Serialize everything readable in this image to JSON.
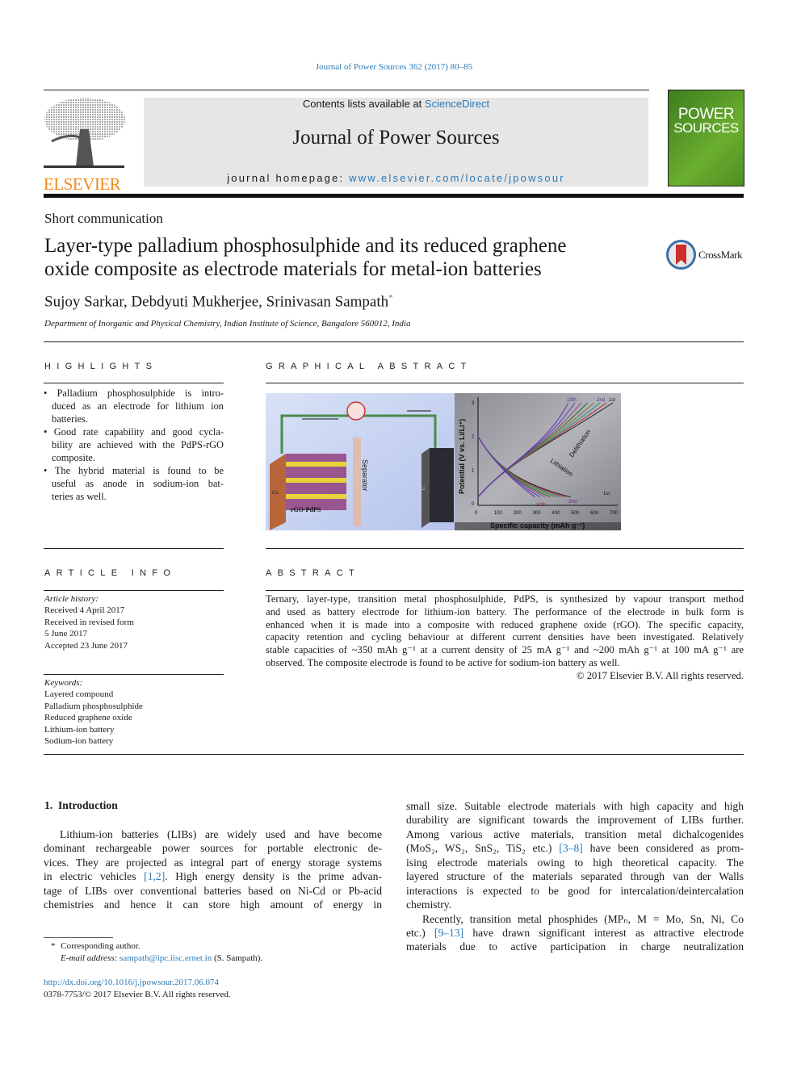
{
  "header": {
    "citation": "Journal of Power Sources 362 (2017) 80–85",
    "contents_prefix": "Contents lists available at ",
    "contents_link": "ScienceDirect",
    "journal_title": "Journal of Power Sources",
    "homepage_prefix": "journal homepage: ",
    "homepage_link": "www.elsevier.com/locate/jpowsour",
    "publisher_logo": "ELSEVIER",
    "cover": {
      "line1": "POWER",
      "line2": "SOURCES",
      "color": "#5a9a2a"
    },
    "crossmark": "CrossMark"
  },
  "article": {
    "type": "Short communication",
    "title_lines": [
      "Layer-type palladium phosphosulphide and its reduced graphene",
      "oxide composite as electrode materials for metal-ion batteries"
    ],
    "authors": "Sujoy Sarkar, Debdyuti Mukherjee, Srinivasan Sampath",
    "author_mark": "*",
    "affiliation": "Department of Inorganic and Physical Chemistry, Indian Institute of Science, Bangalore 560012, India"
  },
  "highlights": {
    "heading": "HIGHLIGHTS",
    "lines": [
      [
        "• Palladium phosphosulphide is intro-"
      ],
      [
        "duced as an electrode for lithium ion"
      ],
      [
        "batteries."
      ],
      [
        "• Good rate capability and good cycla-"
      ],
      [
        "bility are achieved with the PdPS-rGO"
      ],
      [
        "composite."
      ],
      [
        "• The hybrid material is found to be"
      ],
      [
        "useful as anode in sodium-ion bat-"
      ],
      [
        "teries as well."
      ]
    ]
  },
  "graphical_abstract": {
    "heading": "GRAPHICAL ABSTRACT",
    "labels": {
      "separator": "Separator",
      "electrode": "rGO-PdPS",
      "cu": "Cu",
      "li": "Li",
      "ylabel": "Potential (V vs. Li/Li⁺)",
      "xlabel": "Specific capacity (mAh g⁻¹)",
      "delithiation": "Delithiation",
      "lithiation": "Lithiation",
      "cycle_10_top": "10th",
      "cycle_2_top": "2nd",
      "cycle_1_top": "1st",
      "cycle_10_bottom": "10th",
      "cycle_2_bottom": "2nd",
      "cycle_1_bottom": "1st",
      "xticks": [
        "0",
        "100",
        "200",
        "300",
        "400",
        "500",
        "600",
        "700"
      ],
      "yticks": [
        "0",
        "1",
        "2",
        "3"
      ]
    }
  },
  "article_info": {
    "heading": "ARTICLE INFO",
    "history_label": "Article history:",
    "history": [
      "Received 4 April 2017",
      "Received in revised form",
      "5 June 2017",
      "Accepted 23 June 2017"
    ],
    "keywords_label": "Keywords:",
    "keywords": [
      "Layered compound",
      "Palladium phosphosulphide",
      "Reduced graphene oxide",
      "Lithium-ion battery",
      "Sodium-ion battery"
    ]
  },
  "abstract": {
    "heading": "ABSTRACT",
    "lines": [
      [
        "Ternary, layer-type, transition metal phosphosulphide, PdPS, is synthesized by vapour transport method"
      ],
      [
        "and used as battery electrode for lithium-ion battery. The performance of the electrode in bulk form is"
      ],
      [
        "enhanced when it is made into a composite with reduced graphene oxide (rGO). The specific capacity,"
      ],
      [
        "capacity retention and cycling behaviour at different current densities have been investigated. Relatively"
      ],
      [
        "stable capacities of ~350 mAh g⁻¹ at a current density of 25 mA g⁻¹ and ~200 mAh g⁻¹ at 100 mA g⁻¹ are"
      ],
      [
        "observed. The composite electrode is found to be active for sodium-ion battery as well."
      ]
    ],
    "copyright": "© 2017 Elsevier B.V. All rights reserved."
  },
  "intro": {
    "heading": "1.  Introduction",
    "left_lines": [
      [
        "Lithium-ion batteries (LIBs) are widely used and have become"
      ],
      [
        "dominant rechargeable power sources for portable electronic de-"
      ],
      [
        "vices. They are projected as integral part of energy storage systems"
      ],
      [
        "in electric vehicles ",
        {
          "ref": "[1,2]"
        },
        ". High energy density is the prime advan-"
      ],
      [
        "tage of LIBs over conventional batteries based on Ni-Cd or Pb-acid"
      ],
      [
        "chemistries and hence it can store high amount of energy in"
      ]
    ],
    "right_lines": [
      [
        "small size. Suitable electrode materials with high capacity and high"
      ],
      [
        "durability are significant towards the improvement of LIBs further."
      ],
      [
        "Among various active materials, transition metal dichalcogenides"
      ],
      [
        "(MoS₂, WS₂, SnS₂, TiS₂ etc.) ",
        {
          "ref": "[3–8]"
        },
        " have been considered as prom-"
      ],
      [
        "ising electrode materials owing to high theoretical capacity. The"
      ],
      [
        "layered structure of the materials separated through van der Walls"
      ],
      [
        "interactions is expected to be good for intercalation/deintercalation"
      ],
      [
        "chemistry."
      ],
      [
        "Recently, transition metal phosphides (MPₙ, M = Mo, Sn, Ni, Co"
      ],
      [
        "etc.) ",
        {
          "ref": "[9–13]"
        },
        " have drawn significant interest as attractive electrode"
      ],
      [
        "materials due to active participation in charge neutralization"
      ]
    ]
  },
  "footnote": {
    "mark": "*",
    "corresponding": "Corresponding author.",
    "email_label": "E-mail address: ",
    "email": "sampath@ipc.iisc.ernet.in",
    "email_suffix": " (S. Sampath)."
  },
  "footer": {
    "doi": "http://dx.doi.org/10.1016/j.jpowsour.2017.06.074",
    "issn": "0378-7753/© 2017 Elsevier B.V. All rights reserved."
  }
}
